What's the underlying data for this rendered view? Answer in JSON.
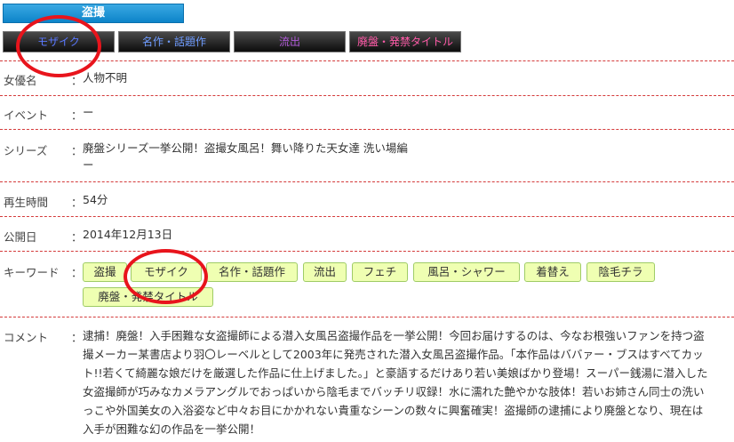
{
  "category": {
    "label": "盗撮"
  },
  "genre_buttons": [
    {
      "label": "モザイク",
      "color": "#5a78ff"
    },
    {
      "label": "名作・話題作",
      "color": "#6f9cff"
    },
    {
      "label": "流出",
      "color": "#b05ad8"
    },
    {
      "label": "廃盤・発禁タイトル",
      "color": "#ff5aa8"
    }
  ],
  "details": {
    "actress": {
      "label": "女優名",
      "colon": "：",
      "value": "人物不明"
    },
    "event": {
      "label": "イベント",
      "colon": "：",
      "value": "ー"
    },
    "series": {
      "label": "シリーズ",
      "colon": "：",
      "value": "廃盤シリーズ一挙公開！盗撮女風呂！舞い降りた天女達 洗い場編",
      "value2": "ー"
    },
    "duration": {
      "label": "再生時間",
      "colon": "：",
      "value": "54分"
    },
    "release": {
      "label": "公開日",
      "colon": "：",
      "value": "2014年12月13日"
    },
    "keywords": {
      "label": "キーワード",
      "colon": "："
    },
    "comment": {
      "label": "コメント",
      "colon": "：",
      "value": "逮捕！廃盤！入手困難な女盗撮師による潜入女風呂盗撮作品を一挙公開！今回お届けするのは、今なお根強いファンを持つ盗撮メーカー某書店より羽〇レーベルとして2003年に発売された潜入女風呂盗撮作品。「本作品はババァー・ブスはすべてカット!!若くて綺麗な娘だけを厳選した作品に仕上げました。」と豪語するだけあり若い美娘ばかり登場！スーパー銭湯に潜入した女盗撮師が巧みなカメラアングルでおっぱいから陰毛までバッチリ収録！水に濡れた艶やかな肢体！若いお姉さん同士の洗いっこや外国美女の入浴姿など中々お目にかかれない貴重なシーンの数々に興奮確実！盗撮師の逮捕により廃盤となり、現在は入手が困難な幻の作品を一挙公開！"
    }
  },
  "keywords": [
    "盗撮",
    "モザイク",
    "名作・話題作",
    "流出",
    "フェチ",
    "風呂・シャワー",
    "着替え",
    "陰毛チラ",
    "廃盤・発禁タイトル"
  ],
  "colors": {
    "accent_blue": "#1a93d6",
    "divider_red": "#d43b3b",
    "tag_bg": "#efffb2",
    "tag_border": "#9fcc66",
    "highlight_red": "#e8141c"
  }
}
